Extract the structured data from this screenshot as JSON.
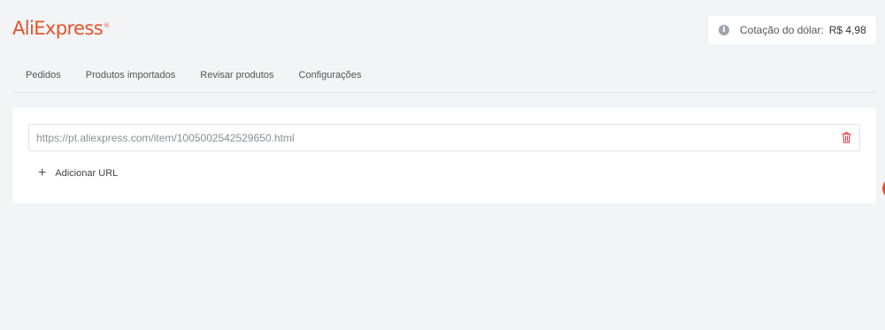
{
  "header": {
    "logo_text": "AliExpress",
    "logo_mark": "®",
    "rate": {
      "icon": "info-icon",
      "label": "Cotação do dólar:",
      "value": "R$ 4,98"
    }
  },
  "tabs": [
    {
      "label": "Pedidos"
    },
    {
      "label": "Produtos importados"
    },
    {
      "label": "Revisar produtos"
    },
    {
      "label": "Configurações"
    }
  ],
  "main": {
    "url_value": "https://pt.aliexpress.com/item/1005002542529650.html",
    "delete_icon": "trash-icon",
    "add_icon": "plus-icon",
    "add_label": "Adicionar URL"
  },
  "colors": {
    "brand": "#e8512a",
    "delete": "#e8474d",
    "background": "#f3f4f6"
  }
}
